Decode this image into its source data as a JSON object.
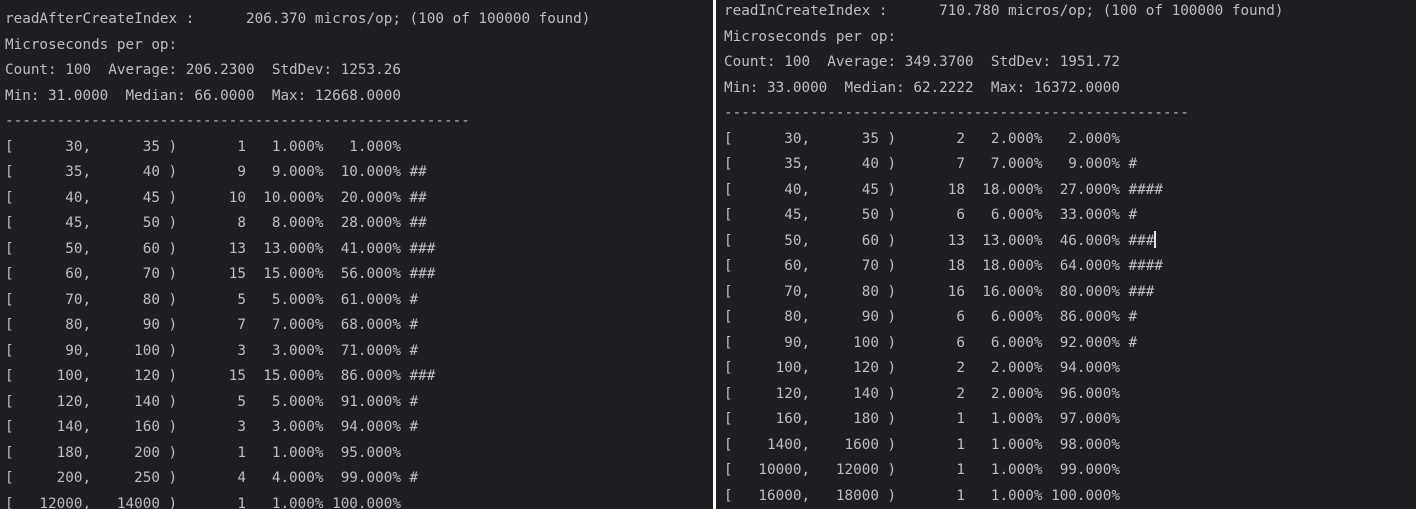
{
  "left_pane": {
    "lines": [
      "readAfterCreateIndex :      206.370 micros/op; (100 of 100000 found)",
      "Microseconds per op:",
      "Count: 100  Average: 206.2300  StdDev: 1253.26",
      "Min: 31.0000  Median: 66.0000  Max: 12668.0000",
      "------------------------------------------------------",
      "[      30,      35 )       1   1.000%   1.000%",
      "[      35,      40 )       9   9.000%  10.000% ##",
      "[      40,      45 )      10  10.000%  20.000% ##",
      "[      45,      50 )       8   8.000%  28.000% ##",
      "[      50,      60 )      13  13.000%  41.000% ###",
      "[      60,      70 )      15  15.000%  56.000% ###",
      "[      70,      80 )       5   5.000%  61.000% #",
      "[      80,      90 )       7   7.000%  68.000% #",
      "[      90,     100 )       3   3.000%  71.000% #",
      "[     100,     120 )      15  15.000%  86.000% ###",
      "[     120,     140 )       5   5.000%  91.000% #",
      "[     140,     160 )       3   3.000%  94.000% #",
      "[     180,     200 )       1   1.000%  95.000%",
      "[     200,     250 )       4   4.000%  99.000% #",
      "[   12000,   14000 )       1   1.000% 100.000%"
    ]
  },
  "right_pane": {
    "lines": [
      "readInCreateIndex :      710.780 micros/op; (100 of 100000 found)",
      "Microseconds per op:",
      "Count: 100  Average: 349.3700  StdDev: 1951.72",
      "Min: 33.0000  Median: 62.2222  Max: 16372.0000",
      "------------------------------------------------------",
      "[      30,      35 )       2   2.000%   2.000%",
      "[      35,      40 )       7   7.000%   9.000% #",
      "[      40,      45 )      18  18.000%  27.000% ####",
      "[      45,      50 )       6   6.000%  33.000% #",
      "[      50,      60 )      13  13.000%  46.000% ###",
      "[      60,      70 )      18  18.000%  64.000% ####",
      "[      70,      80 )      16  16.000%  80.000% ###",
      "[      80,      90 )       6   6.000%  86.000% #",
      "[      90,     100 )       6   6.000%  92.000% #",
      "[     100,     120 )       2   2.000%  94.000%",
      "[     120,     140 )       2   2.000%  96.000%",
      "[     160,     180 )       1   1.000%  97.000%",
      "[    1400,    1600 )       1   1.000%  98.000%",
      "[   10000,   12000 )       1   1.000%  99.000%",
      "[   16000,   18000 )       1   1.000% 100.000%"
    ],
    "cursor_line": 9
  },
  "colors": {
    "background": "#1e1f22",
    "text": "#bcbec4",
    "divider": "#ffffff"
  }
}
